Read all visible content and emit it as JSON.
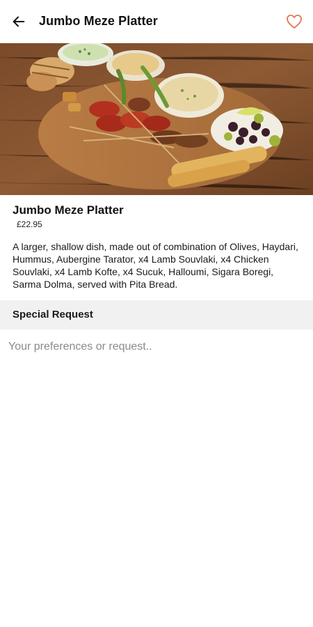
{
  "header": {
    "title": "Jumbo Meze Platter",
    "back_icon": "arrow-left-icon",
    "favorite_icon": "heart-outline-icon",
    "accent_color": "#e8734a"
  },
  "item": {
    "name": "Jumbo Meze Platter",
    "price": "£22.95",
    "description": "A larger, shallow dish, made out of combination of Olives, Haydari, Hummus, Aubergine Tarator, x4 Lamb Souvlaki, x4 Chicken Souvlaki, x4 Lamb Kofte, x4 Sucuk, Halloumi, Sigara Boregi, Sarma Dolma, served with Pita Bread."
  },
  "special_request": {
    "title": "Special Request",
    "placeholder": "Your preferences or request.."
  }
}
